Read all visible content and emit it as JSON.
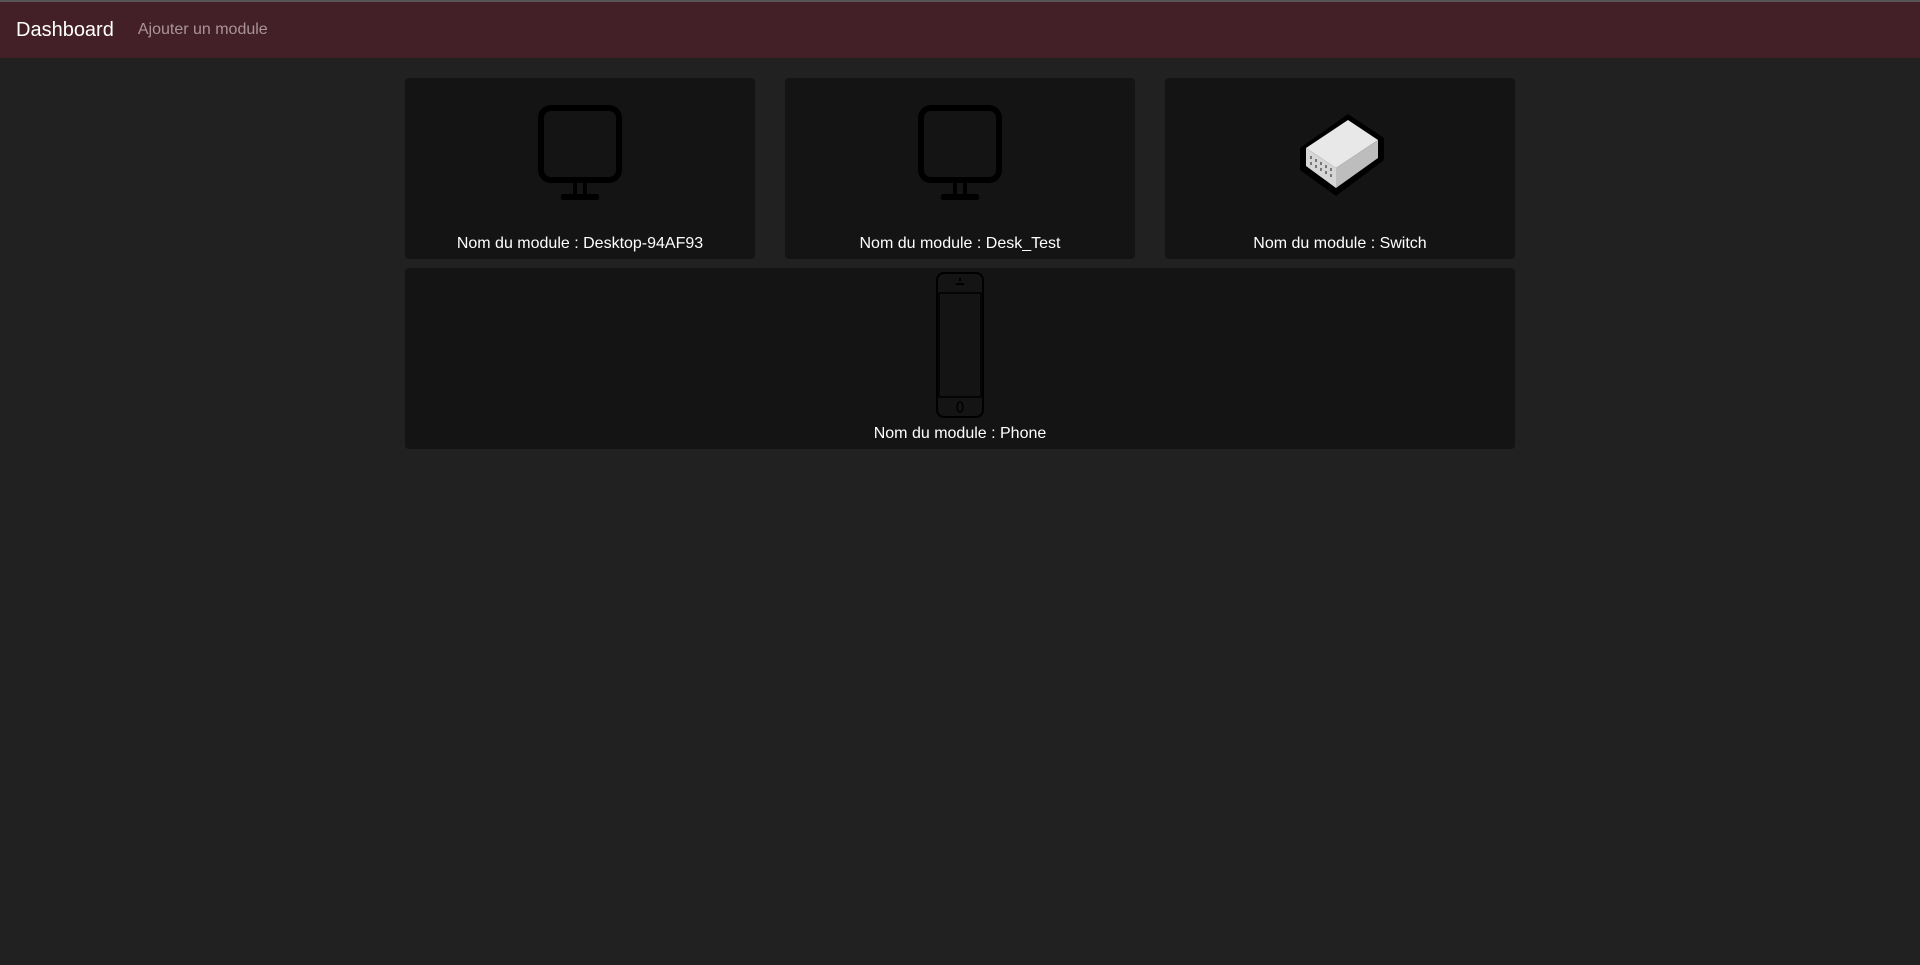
{
  "nav": {
    "brand": "Dashboard",
    "add_module": "Ajouter un module"
  },
  "modules": [
    {
      "label": "Nom du module : Desktop-94AF93",
      "icon": "monitor-icon"
    },
    {
      "label": "Nom du module : Desk_Test",
      "icon": "monitor-icon"
    },
    {
      "label": "Nom du module : Switch",
      "icon": "switch-icon"
    },
    {
      "label": "Nom du module : Phone",
      "icon": "phone-icon"
    }
  ]
}
